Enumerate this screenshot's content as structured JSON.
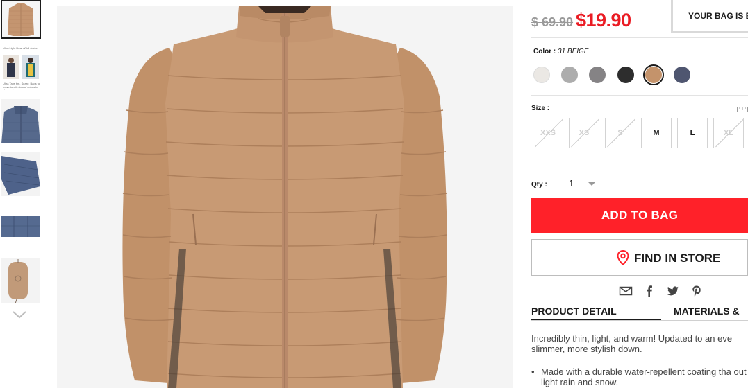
{
  "thumbnails": {
    "items": [
      {
        "name": "thumbnail-front-beige"
      },
      {
        "name": "thumbnail-models",
        "caption_title": "Ultra Light Down Wall Jacket",
        "caption_body": "Ultra Tabs tim. Seard: Bags to move to with lots of colors to choose from"
      },
      {
        "name": "thumbnail-navy-collar"
      },
      {
        "name": "thumbnail-navy-flat"
      },
      {
        "name": "thumbnail-navy-detail"
      },
      {
        "name": "thumbnail-pouch"
      }
    ]
  },
  "product": {
    "old_price": "$ 69.90",
    "new_price": "$19.90",
    "color_label": "Color :",
    "color_value": "31 BEIGE",
    "size_label": "Size :",
    "qty_label": "Qty :",
    "qty_value": "1",
    "add_to_bag": "ADD TO BAG",
    "find_in_store": "FIND IN STORE"
  },
  "bag": {
    "text": "YOUR BAG IS EM"
  },
  "colors": [
    {
      "name": "off-white",
      "hex": "#ebe8e4"
    },
    {
      "name": "light-gray",
      "hex": "#adadad"
    },
    {
      "name": "gray",
      "hex": "#858385"
    },
    {
      "name": "black",
      "hex": "#2d2d2d"
    },
    {
      "name": "beige",
      "hex": "#c4936b",
      "selected": true
    },
    {
      "name": "navy-gray",
      "hex": "#4f5670"
    }
  ],
  "sizes": [
    {
      "label": "XXS",
      "available": false
    },
    {
      "label": "XS",
      "available": false
    },
    {
      "label": "S",
      "available": false
    },
    {
      "label": "M",
      "available": true
    },
    {
      "label": "L",
      "available": true
    },
    {
      "label": "XL",
      "available": false
    }
  ],
  "share": {
    "icons": [
      "mail-icon",
      "facebook-icon",
      "twitter-icon",
      "pinterest-icon"
    ]
  },
  "tabs": {
    "product_detail": "PRODUCT DETAIL",
    "materials": "MATERIALS &"
  },
  "description": {
    "intro": "Incredibly thin, light, and warm! Updated to an eve slimmer, more stylish down.",
    "bullet": "Made with a durable water-repellent coating tha out light rain and snow."
  },
  "theme": {
    "accent_red": "#ff2129",
    "price_red": "#ea1c24",
    "jacket_color": "#c49570"
  }
}
